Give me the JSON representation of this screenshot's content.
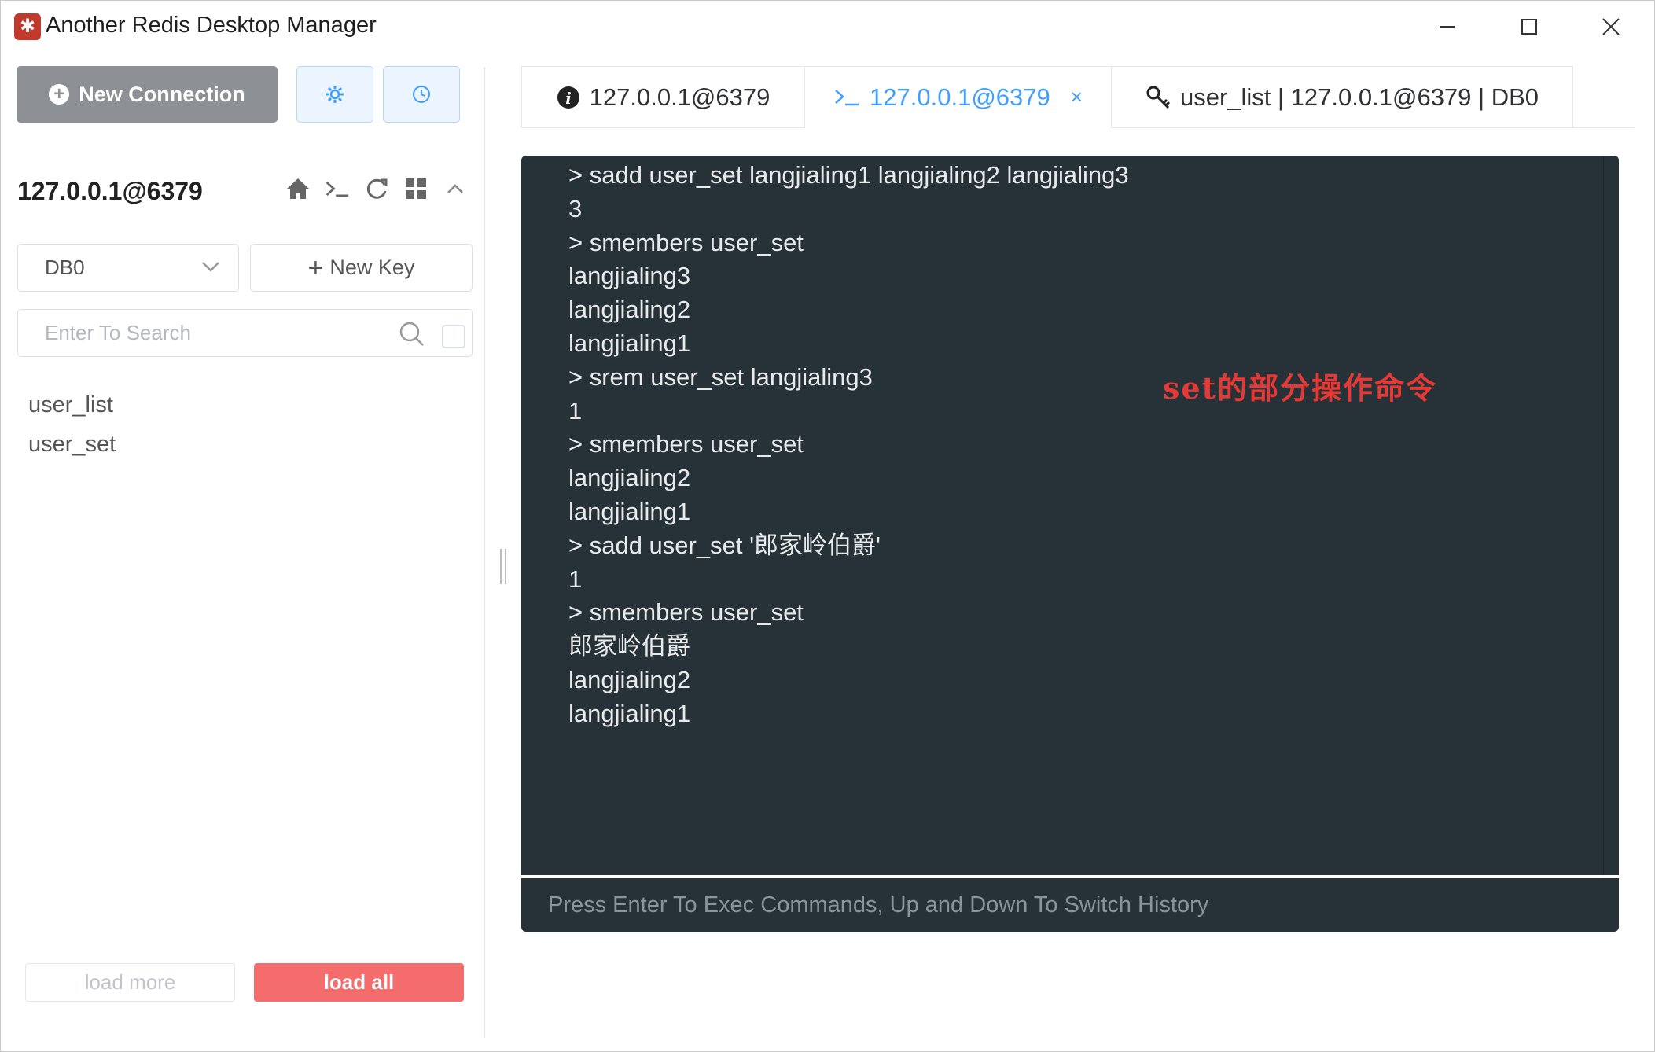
{
  "window": {
    "title": "Another Redis Desktop Manager",
    "app_icon": "redis-logo-icon"
  },
  "sidebar": {
    "new_connection_label": "New Connection",
    "connection_name": "127.0.0.1@6379",
    "db_select_value": "DB0",
    "new_key_label": "New Key",
    "search_placeholder": "Enter To Search",
    "keys": [
      "user_list",
      "user_set"
    ],
    "load_more_label": "load more",
    "load_all_label": "load all"
  },
  "tabs": [
    {
      "icon": "info-icon",
      "label": "127.0.0.1@6379"
    },
    {
      "icon": "terminal-icon",
      "label": "127.0.0.1@6379",
      "active": true,
      "close": "×"
    },
    {
      "icon": "key-icon",
      "label": "user_list | 127.0.0.1@6379 | DB0"
    }
  ],
  "console": {
    "lines": [
      "> sadd user_set langjialing1 langjialing2 langjialing3",
      "3",
      "> smembers user_set",
      "langjialing3",
      "langjialing2",
      "langjialing1",
      "> srem user_set langjialing3",
      "1",
      "> smembers user_set",
      "langjialing2",
      "langjialing1",
      "> sadd user_set '郎家岭伯爵'",
      "1",
      "> smembers user_set",
      "郎家岭伯爵",
      "langjialing2",
      "langjialing1"
    ],
    "annotation": "set的部分操作命令",
    "input_placeholder": "Press Enter To Exec Commands, Up and Down To Switch History"
  },
  "colors": {
    "console_bg": "#263238",
    "accent": "#409eff",
    "danger": "#f56c6c",
    "annotation": "#e53935"
  }
}
